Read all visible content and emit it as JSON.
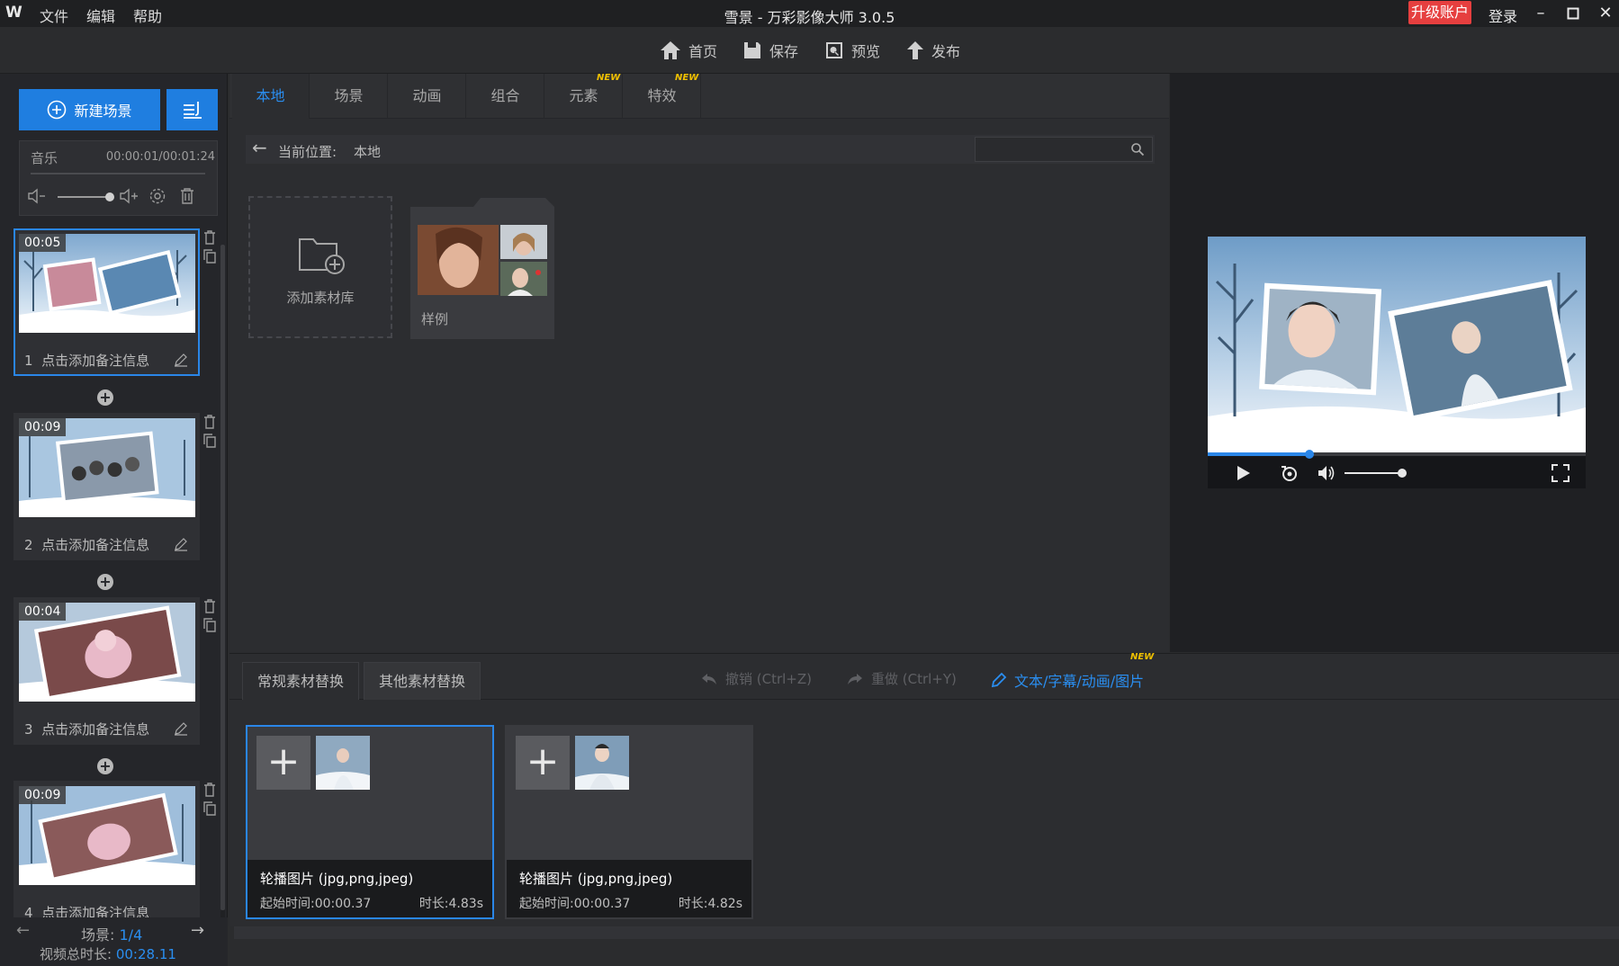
{
  "app": {
    "title": "雪景 - 万彩影像大师 3.0.5",
    "logo": "W",
    "menu": [
      "文件",
      "编辑",
      "帮助"
    ],
    "upgrade_label": "升级账户",
    "login_label": "登录"
  },
  "toolbar": {
    "home": "首页",
    "save": "保存",
    "preview": "预览",
    "publish": "发布"
  },
  "left": {
    "new_scene_label": "新建场景",
    "music": {
      "label": "音乐",
      "time": "00:00:01/00:01:24"
    },
    "scenes": [
      {
        "time": "00:05",
        "num": "1",
        "note": "点击添加备注信息"
      },
      {
        "time": "00:09",
        "num": "2",
        "note": "点击添加备注信息"
      },
      {
        "time": "00:04",
        "num": "3",
        "note": "点击添加备注信息"
      },
      {
        "time": "00:09",
        "num": "4",
        "note": "点击添加备注信息"
      }
    ],
    "footer": {
      "scene_label": "场景:",
      "scene_index": "1/4",
      "total_label": "视频总时长:",
      "total_time": "00:28.11"
    }
  },
  "tabs": [
    {
      "label": "本地",
      "badge": ""
    },
    {
      "label": "场景",
      "badge": ""
    },
    {
      "label": "动画",
      "badge": ""
    },
    {
      "label": "组合",
      "badge": ""
    },
    {
      "label": "元素",
      "badge": "NEW"
    },
    {
      "label": "特效",
      "badge": "NEW"
    }
  ],
  "breadcrumb": {
    "label": "当前位置:",
    "path": "本地"
  },
  "search": {
    "value": "",
    "placeholder": ""
  },
  "library": {
    "add_label": "添加素材库",
    "sample_label": "样例"
  },
  "bottom": {
    "tabs": [
      "常规素材替换",
      "其他素材替换"
    ],
    "undo": "撤销 (Ctrl+Z)",
    "redo": "重做 (Ctrl+Y)",
    "text_link": "文本/字幕/动画/图片",
    "text_badge": "NEW",
    "cards": [
      {
        "name": "轮播图片 (jpg,png,jpeg)",
        "start": "起始时间:00:00.37",
        "duration": "时长:4.83s"
      },
      {
        "name": "轮播图片 (jpg,png,jpeg)",
        "start": "起始时间:00:00.37",
        "duration": "时长:4.82s"
      }
    ]
  },
  "player": {
    "progress": 0.27,
    "volume": 0.9
  },
  "colors": {
    "accent": "#2a86e8",
    "upgrade": "#e63f3f",
    "badge": "#f0c000"
  }
}
